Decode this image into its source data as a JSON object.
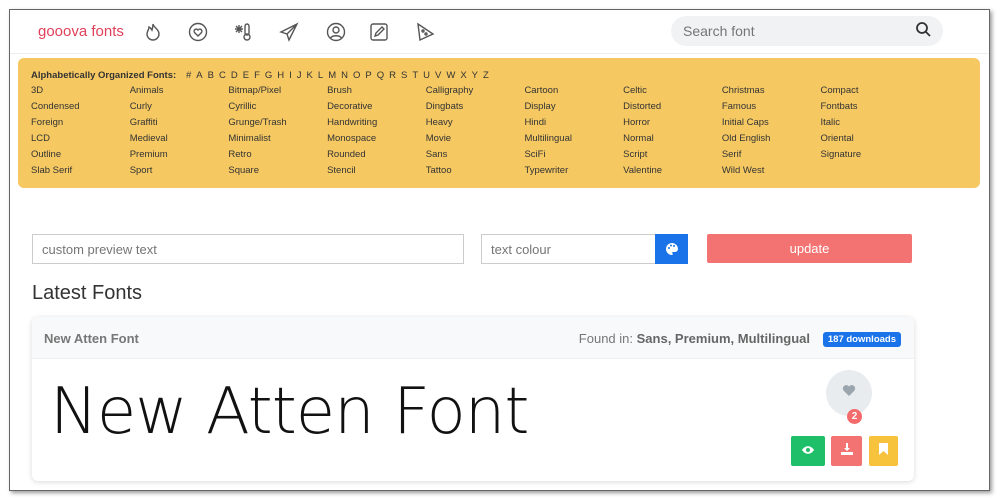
{
  "header": {
    "logo": "gooova fonts",
    "search_placeholder": "Search font",
    "nav_icons": [
      "fire-icon",
      "heart-icon",
      "snow-thermometer-icon",
      "paper-plane-icon",
      "user-icon",
      "edit-icon",
      "pizza-icon"
    ]
  },
  "categories": {
    "title": "Alphabetically Organized Fonts:",
    "letters": [
      "#",
      "A",
      "B",
      "C",
      "D",
      "E",
      "F",
      "G",
      "H",
      "I",
      "J",
      "K",
      "L",
      "M",
      "N",
      "O",
      "P",
      "Q",
      "R",
      "S",
      "T",
      "U",
      "V",
      "W",
      "X",
      "Y",
      "Z"
    ],
    "items": [
      "3D",
      "Animals",
      "Bitmap/Pixel",
      "Brush",
      "Calligraphy",
      "Cartoon",
      "Celtic",
      "Christmas",
      "Compact",
      "Condensed",
      "Curly",
      "Cyrillic",
      "Decorative",
      "Dingbats",
      "Display",
      "Distorted",
      "Famous",
      "Fontbats",
      "Foreign",
      "Graffiti",
      "Grunge/Trash",
      "Handwriting",
      "Heavy",
      "Hindi",
      "Horror",
      "Initial Caps",
      "Italic",
      "LCD",
      "Medieval",
      "Minimalist",
      "Monospace",
      "Movie",
      "Multilingual",
      "Normal",
      "Old English",
      "Oriental",
      "Outline",
      "Premium",
      "Retro",
      "Rounded",
      "Sans",
      "SciFi",
      "Script",
      "Serif",
      "Signature",
      "Slab Serif",
      "Sport",
      "Square",
      "Stencil",
      "Tattoo",
      "Typewriter",
      "Valentine",
      "Wild West"
    ]
  },
  "controls": {
    "preview_placeholder": "custom preview text",
    "colour_placeholder": "text colour",
    "update_label": "update"
  },
  "latest": {
    "heading": "Latest Fonts",
    "card": {
      "name": "New Atten Font",
      "found_label": "Found in:",
      "found_in": "Sans, Premium, Multilingual",
      "downloads": "187 downloads",
      "preview": "New Atten Font",
      "likes": "2"
    }
  },
  "colors": {
    "accent": "#1a73e8",
    "update": "#f37272",
    "banner": "#f5c862",
    "view": "#1fbf6a",
    "download": "#f37272",
    "bookmark": "#f7c23c"
  }
}
